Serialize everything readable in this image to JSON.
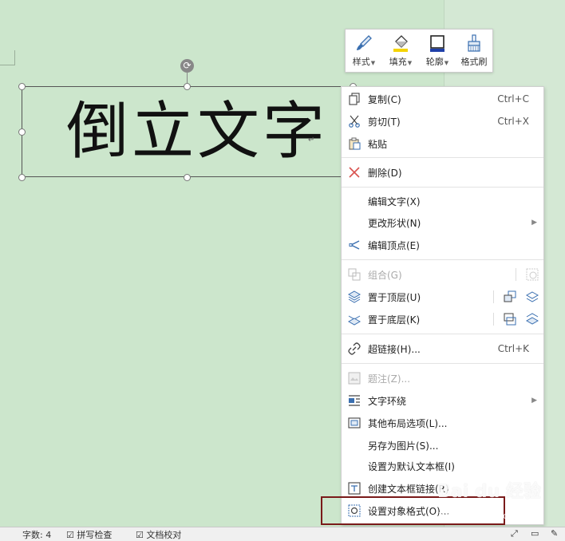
{
  "document": {
    "textbox_text": "倒立文字",
    "para_mark": "↵"
  },
  "mini_toolbar": {
    "items": [
      {
        "label": "样式",
        "icon": "brush-icon",
        "has_dropdown": true
      },
      {
        "label": "填充",
        "icon": "fill-bucket-icon",
        "has_dropdown": true
      },
      {
        "label": "轮廓",
        "icon": "outline-icon",
        "has_dropdown": true
      },
      {
        "label": "格式刷",
        "icon": "format-painter-icon",
        "has_dropdown": false
      }
    ]
  },
  "context_menu": {
    "copy": {
      "label": "复制(C)",
      "shortcut": "Ctrl+C"
    },
    "cut": {
      "label": "剪切(T)",
      "shortcut": "Ctrl+X"
    },
    "paste": {
      "label": "粘贴"
    },
    "delete": {
      "label": "删除(D)"
    },
    "edit_text": {
      "label": "编辑文字(X)"
    },
    "change_shape": {
      "label": "更改形状(N)"
    },
    "edit_points": {
      "label": "编辑顶点(E)"
    },
    "group": {
      "label": "组合(G)"
    },
    "bring_to_front": {
      "label": "置于顶层(U)"
    },
    "send_to_back": {
      "label": "置于底层(K)"
    },
    "hyperlink": {
      "label": "超链接(H)...",
      "shortcut": "Ctrl+K"
    },
    "comment": {
      "label": "题注(Z)..."
    },
    "text_wrap": {
      "label": "文字环绕"
    },
    "more_layout": {
      "label": "其他布局选项(L)..."
    },
    "save_as_picture": {
      "label": "另存为图片(S)..."
    },
    "set_default_textbox": {
      "label": "设置为默认文本框(I)"
    },
    "create_textbox_link": {
      "label": "创建文本框链接(R)"
    },
    "format_object": {
      "label": "设置对象格式(O)..."
    }
  },
  "statusbar": {
    "left_item": "字数: 4",
    "spell_check": "拼写检查",
    "doc_check": "文档校对"
  },
  "watermark": {
    "text": "Bai du 经验",
    "sub": "jingyan.baidu.com"
  },
  "colors": {
    "page_bg": "#cce6cc",
    "highlight_border": "#7a1a1a",
    "delete_red": "#d9534f",
    "icon_blue": "#3a6fb0"
  }
}
